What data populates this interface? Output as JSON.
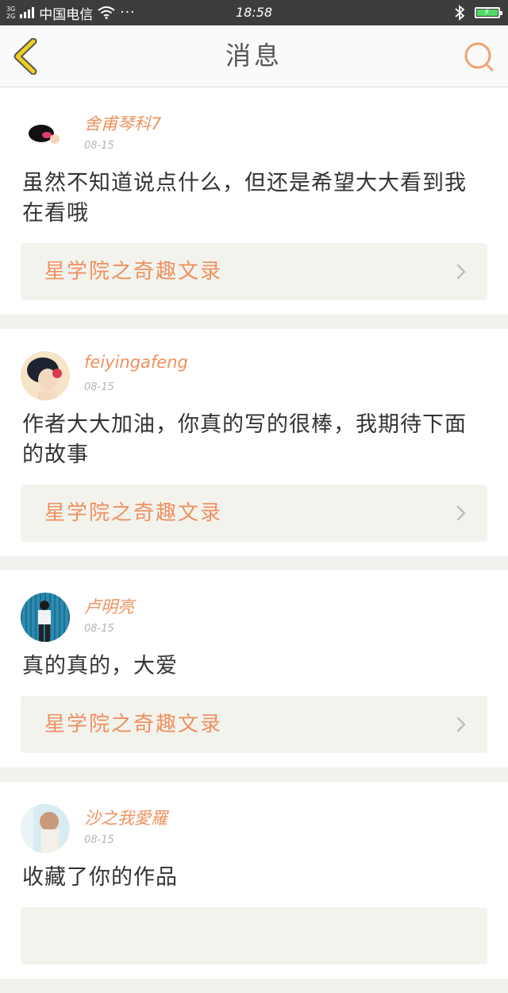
{
  "status_bar": {
    "network": "3G 2G",
    "carrier": "中国电信",
    "dots": "···",
    "time": "18:58"
  },
  "header": {
    "title": "消息",
    "back_icon": "chevron-left-icon",
    "search_icon": "search-icon"
  },
  "colors": {
    "accent": "#ee9160",
    "back_icon": "#e6c400",
    "background": "#f1f1ed"
  },
  "messages": [
    {
      "username": "舍甫琴科7",
      "date": "08-15",
      "text": "虽然不知道说点什么，但还是希望大大看到我在看哦",
      "work_title": "星学院之奇趣文录"
    },
    {
      "username": "feiyingafeng",
      "date": "08-15",
      "text": "作者大大加油，你真的写的很棒，我期待下面的故事",
      "work_title": "星学院之奇趣文录"
    },
    {
      "username": "卢明亮",
      "date": "08-15",
      "text": "真的真的，大爱",
      "work_title": "星学院之奇趣文录"
    },
    {
      "username": "沙之我愛羅",
      "date": "08-15",
      "text": "收藏了你的作品",
      "work_title": ""
    }
  ]
}
